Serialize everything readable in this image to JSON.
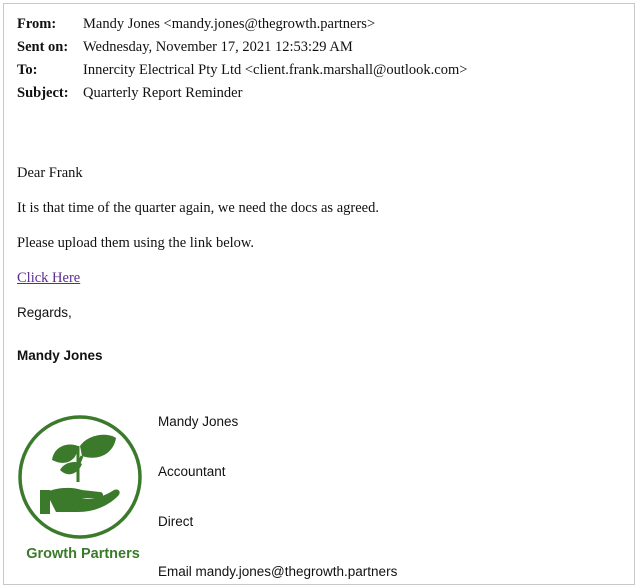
{
  "email": {
    "header": {
      "from_label": "From:",
      "from_value": "Mandy Jones <mandy.jones@thegrowth.partners>",
      "sent_label": "Sent on:",
      "sent_value": "Wednesday, November 17, 2021 12:53:29 AM",
      "to_label": "To:",
      "to_value": "Innercity Electrical Pty Ltd <client.frank.marshall@outlook.com>",
      "subject_label": "Subject:",
      "subject_value": "Quarterly Report Reminder"
    },
    "body": {
      "greeting": "Dear Frank",
      "line1": "It is that time of the quarter again, we need the docs as agreed.",
      "line2": "Please upload them using the link below.",
      "link_text": "Click Here",
      "closing": "Regards,",
      "sender_name": "Mandy Jones"
    },
    "signature": {
      "name": "Mandy Jones",
      "title": "Accountant",
      "direct": "Direct",
      "email": "Email mandy.jones@thegrowth.partners",
      "logo_text": "Growth Partners",
      "logo_icon": "hand-with-leaves-icon",
      "brand_color": "#3b7a2a"
    }
  }
}
